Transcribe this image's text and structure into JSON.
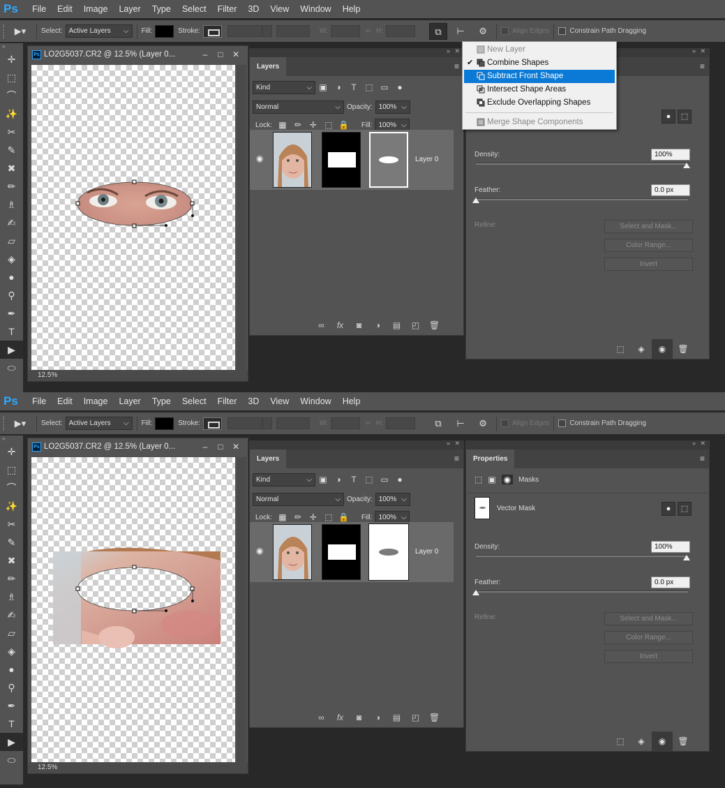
{
  "app": {
    "logo": "Ps",
    "menu": [
      "File",
      "Edit",
      "Image",
      "Layer",
      "Type",
      "Select",
      "Filter",
      "3D",
      "View",
      "Window",
      "Help"
    ]
  },
  "options": {
    "select_label": "Select:",
    "select_value": "Active Layers",
    "fill_label": "Fill:",
    "stroke_label": "Stroke:",
    "w_label": "W:",
    "h_label": "H:",
    "align_edges": "Align Edges",
    "constrain": "Constrain Path Dragging"
  },
  "document": {
    "title": "LO2G5037.CR2 @ 12.5% (Layer 0...",
    "zoom": "12.5%"
  },
  "layers": {
    "tab": "Layers",
    "filter_value": "Kind",
    "blend_mode": "Normal",
    "opacity_label": "Opacity:",
    "opacity_value": "100%",
    "lock_label": "Lock:",
    "fill_label": "Fill:",
    "fill_value": "100%",
    "layer_name": "Layer 0"
  },
  "properties": {
    "tab": "Properties",
    "masks_label": "Masks",
    "vector_mask": "Vector Mask",
    "density_label": "Density:",
    "density_value": "100%",
    "feather_label": "Feather:",
    "feather_value": "0.0 px",
    "refine_label": "Refine:",
    "select_mask_btn": "Select and Mask...",
    "color_range_btn": "Color Range...",
    "invert_btn": "Invert"
  },
  "dropdown": {
    "items": [
      "New Layer",
      "Combine Shapes",
      "Subtract Front Shape",
      "Intersect Shape Areas",
      "Exclude Overlapping Shapes"
    ],
    "merge": "Merge Shape Components",
    "checked_index": 1,
    "selected_index": 2
  },
  "colors": {
    "ui_bg": "#535353",
    "dark_bg": "#282828",
    "accent_blue": "#0a7ad6",
    "ps_blue": "#31a8ff"
  }
}
